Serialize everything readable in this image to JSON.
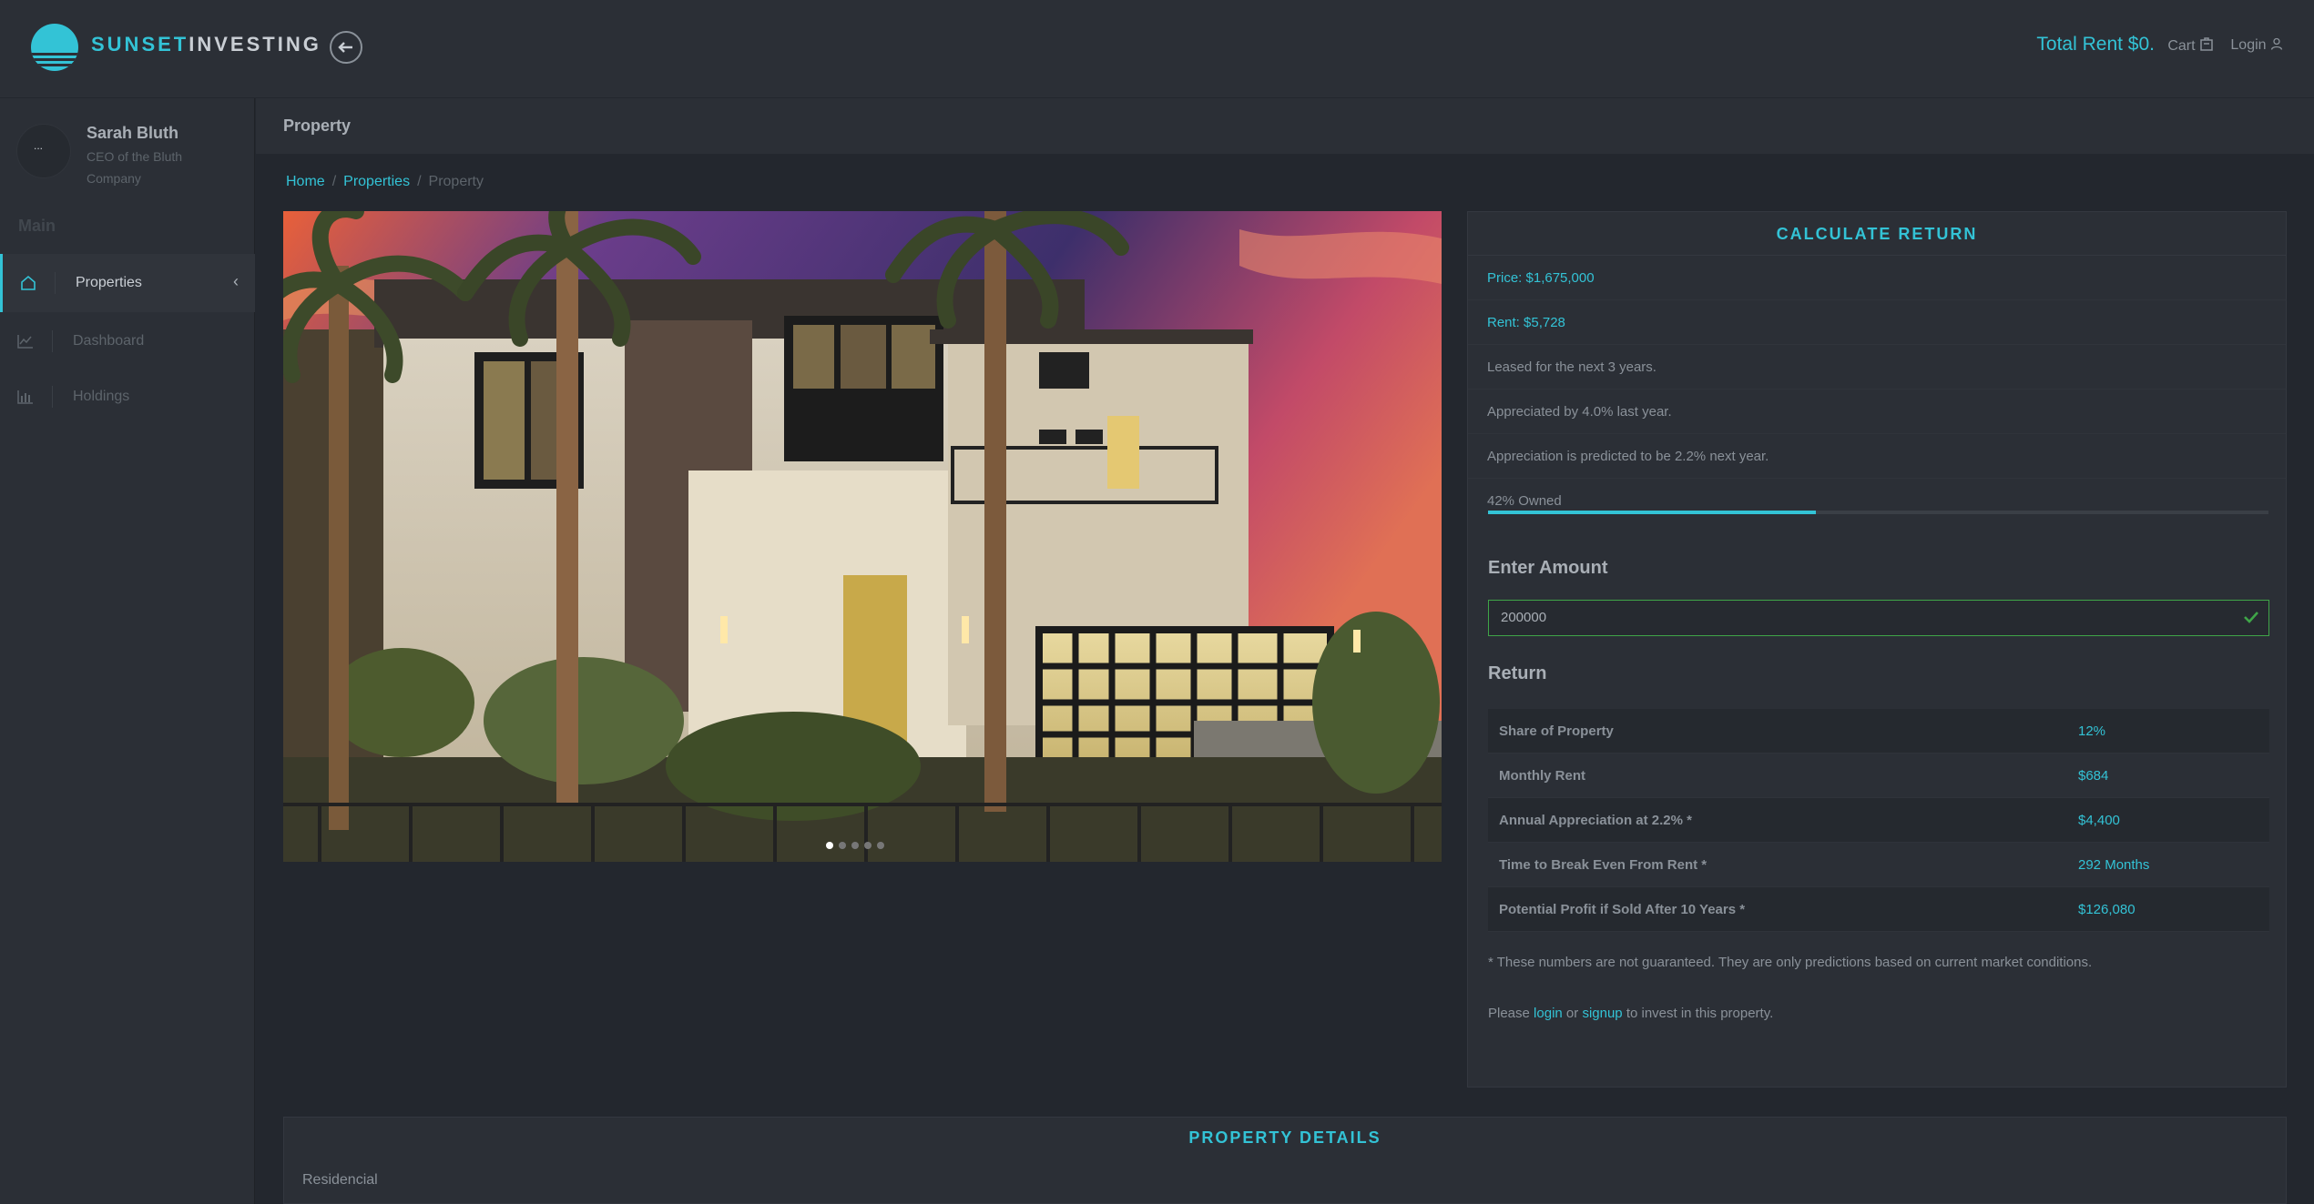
{
  "brand": {
    "part1": "SUNSET",
    "part2": "INVESTING"
  },
  "topbar": {
    "total_rent": "Total Rent $0.",
    "cart_label": "Cart",
    "login_label": "Login"
  },
  "user": {
    "name": "Sarah Bluth",
    "role": "CEO of the Bluth Company",
    "avatar_alt": "..."
  },
  "sidebar": {
    "section": "Main",
    "items": [
      {
        "label": "Properties",
        "icon": "home-icon",
        "active": true
      },
      {
        "label": "Dashboard",
        "icon": "line-chart-icon",
        "active": false
      },
      {
        "label": "Holdings",
        "icon": "bar-chart-icon",
        "active": false
      }
    ]
  },
  "page": {
    "title": "Property"
  },
  "breadcrumb": {
    "home": "Home",
    "properties": "Properties",
    "current": "Property"
  },
  "carousel": {
    "slide_count": 5,
    "active_index": 0
  },
  "calc": {
    "title": "CALCULATE RETURN",
    "price": "Price: $1,675,000",
    "rent": "Rent: $5,728",
    "leased": "Leased for the next 3 years.",
    "appreciated": "Appreciated by 4.0% last year.",
    "predicted": "Appreciation is predicted to be 2.2% next year.",
    "owned_label": "42% Owned",
    "owned_fraction": 0.42,
    "enter_amount_label": "Enter Amount",
    "amount_value": "200000",
    "return_label": "Return",
    "rows": [
      {
        "label": "Share of Property",
        "value": "12%"
      },
      {
        "label": "Monthly Rent",
        "value": "$684"
      },
      {
        "label": "Annual Appreciation at 2.2% *",
        "value": "$4,400"
      },
      {
        "label": "Time to Break Even From Rent *",
        "value": "292 Months"
      },
      {
        "label": "Potential Profit if Sold After 10 Years *",
        "value": "$126,080"
      }
    ],
    "disclaimer": "* These numbers are not guaranteed. They are only predictions based on current market conditions.",
    "invite": {
      "pre": "Please",
      "login": "login",
      "or": "or",
      "signup": "signup",
      "post": "to invest in this property."
    }
  },
  "details": {
    "title": "PROPERTY DETAILS",
    "type": "Residencial"
  },
  "colors": {
    "accent": "#33c3d6",
    "success": "#3fa548",
    "panel": "#2b2f36",
    "background": "#23272e"
  }
}
